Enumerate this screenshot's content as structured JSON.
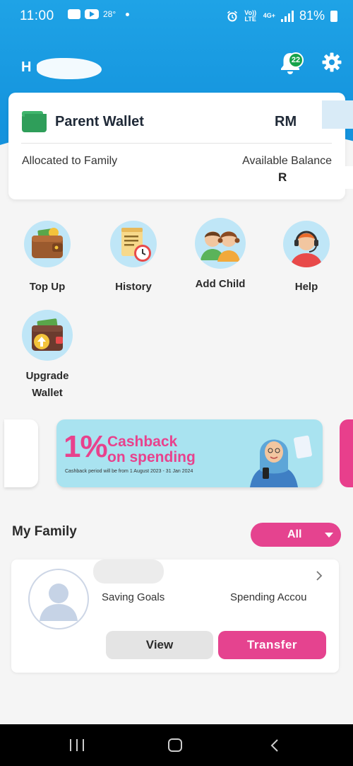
{
  "status_bar": {
    "time": "11:00",
    "temperature": "28°",
    "volte": "Vo)) LTE",
    "network": "4G+",
    "battery": "81%"
  },
  "header": {
    "greeting_initial": "H",
    "notification_count": "22"
  },
  "wallet": {
    "title": "Parent Wallet",
    "currency": "RM",
    "allocated_label": "Allocated to Family",
    "available_label": "Available Balance",
    "available_value_visible": "R"
  },
  "actions": [
    {
      "label": "Top Up",
      "icon": "wallet-coins-icon"
    },
    {
      "label": "History",
      "icon": "receipt-clock-icon"
    },
    {
      "label": "Add Child",
      "icon": "children-icon"
    },
    {
      "label": "Help",
      "icon": "support-agent-icon"
    },
    {
      "label": "Upgrade\nWallet",
      "icon": "wallet-upgrade-icon"
    }
  ],
  "banner": {
    "percent": "1%",
    "line1": "Cashback",
    "line2": "on spending",
    "fine_print": "Cashback period will be from 1 August 2023 - 31 Jan 2024"
  },
  "family": {
    "title": "My Family",
    "filter": "All",
    "child": {
      "saving_label": "Saving Goals",
      "spending_label": "Spending Accou",
      "view_button": "View",
      "transfer_button": "Transfer"
    }
  },
  "colors": {
    "header_blue": "#1a97df",
    "accent_pink": "#e5438f",
    "wallet_green": "#2f9e5a"
  }
}
